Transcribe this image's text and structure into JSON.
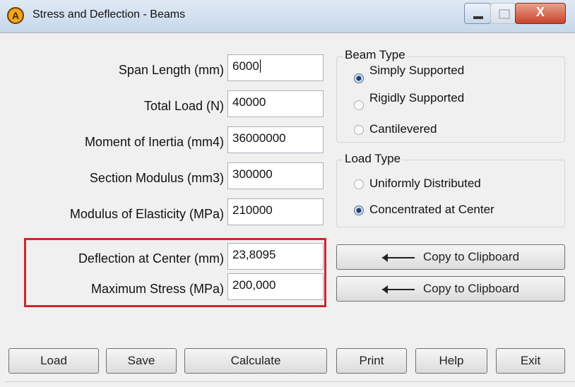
{
  "window": {
    "title": "Stress and Deflection - Beams",
    "app_icon_letter": "A",
    "close_glyph": "X"
  },
  "fields": [
    {
      "label": "Span Length (mm)",
      "value": "6000"
    },
    {
      "label": "Total Load (N)",
      "value": "40000"
    },
    {
      "label": "Moment of Inertia (mm4)",
      "value": "36000000"
    },
    {
      "label": "Section Modulus (mm3)",
      "value": "300000"
    },
    {
      "label": "Modulus of Elasticity (MPa)",
      "value": "210000"
    }
  ],
  "results": [
    {
      "label": "Deflection at Center (mm)",
      "value": "23,8095",
      "copy_label": "Copy to Clipboard"
    },
    {
      "label": "Maximum Stress (MPa)",
      "value": "200,000",
      "copy_label": "Copy to Clipboard"
    }
  ],
  "beam_type": {
    "title": "Beam Type",
    "options": [
      {
        "label": "Simply Supported",
        "selected": true
      },
      {
        "label": "Rigidly Supported",
        "selected": false
      },
      {
        "label": "Cantilevered",
        "selected": false
      }
    ]
  },
  "load_type": {
    "title": "Load Type",
    "options": [
      {
        "label": "Uniformly Distributed",
        "selected": false
      },
      {
        "label": "Concentrated at Center",
        "selected": true
      }
    ]
  },
  "buttons": {
    "load": "Load",
    "save": "Save",
    "calculate": "Calculate",
    "print": "Print",
    "help": "Help",
    "exit": "Exit"
  },
  "colors": {
    "highlight": "#d2242b",
    "close_button": "#c9432b",
    "app_icon": "#f3a51c"
  }
}
